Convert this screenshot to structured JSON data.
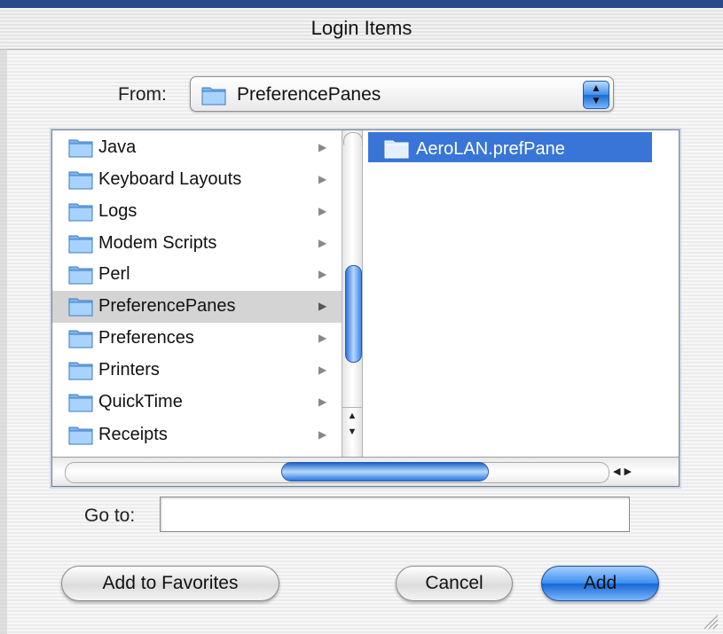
{
  "window": {
    "title": "Login Items"
  },
  "from": {
    "label": "From:",
    "selected": "PreferencePanes"
  },
  "column1": {
    "items": [
      {
        "name": "Java",
        "selected": false
      },
      {
        "name": "Keyboard Layouts",
        "selected": false
      },
      {
        "name": "Logs",
        "selected": false
      },
      {
        "name": "Modem Scripts",
        "selected": false
      },
      {
        "name": "Perl",
        "selected": false
      },
      {
        "name": "PreferencePanes",
        "selected": true
      },
      {
        "name": "Preferences",
        "selected": false
      },
      {
        "name": "Printers",
        "selected": false
      },
      {
        "name": "QuickTime",
        "selected": false
      },
      {
        "name": "Receipts",
        "selected": false
      }
    ]
  },
  "column2": {
    "items": [
      {
        "name": "AeroLAN.prefPane",
        "selected": true
      }
    ]
  },
  "goto": {
    "label": "Go to:",
    "value": ""
  },
  "buttons": {
    "favorites": "Add to Favorites",
    "cancel": "Cancel",
    "add": "Add"
  },
  "colors": {
    "selection": "#3875d7",
    "accent": "#2b76de",
    "title_rule": "#264b86"
  }
}
